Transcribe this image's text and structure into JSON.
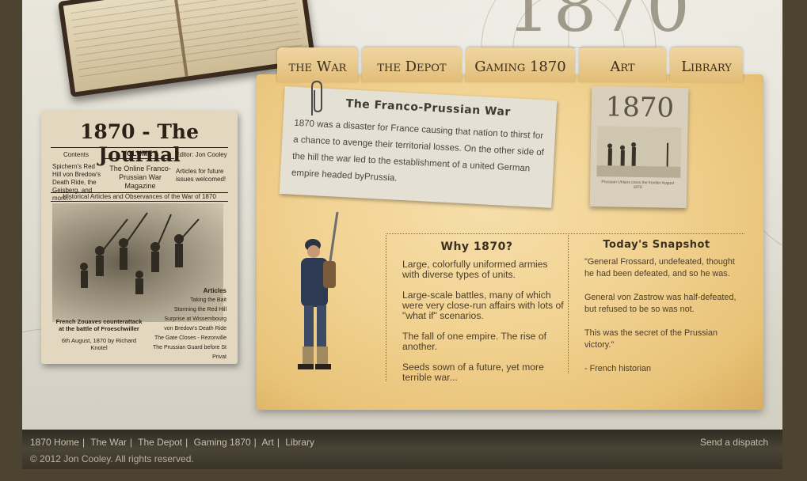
{
  "header": {
    "year_mark": "1870"
  },
  "tabs": [
    {
      "label": "the War"
    },
    {
      "label": "the Depot"
    },
    {
      "label": "Gaming 1870"
    },
    {
      "label": "Art"
    },
    {
      "label": "Library"
    }
  ],
  "journal": {
    "title": "1870 - The Journal",
    "contents_label": "Contents",
    "volume": "VOLUME 1",
    "editor": "Editor: Jon Cooley",
    "contents_text": "Spichern's Red Hill von Bredow's Death Ride, the Geisberg, and more...",
    "magazine": "The Online Franco-Prussian War Magazine",
    "future": "Articles for future issues welcomed!",
    "subtitle": "Historical Articles and Observances of the War of 1870",
    "articles_label": "Articles",
    "articles": [
      "Taking the Bait",
      "Storming the Red Hill",
      "Surprise at Wissembourg",
      "von Bredow's Death Ride",
      "The Gate Closes - Rezonville",
      "The Prussian Guard before St Privat"
    ],
    "caption": "French Zouaves counterattack at the battle of Froeschwiller",
    "caption_date": "6th August, 1870 by Richard Knotel"
  },
  "intro": {
    "title": "The Franco-Prussian War",
    "body": "1870 was a disaster for France causing that nation to thirst for a chance to avenge their territorial losses. On the other side of the hill the war led to the establishment of a united German empire headed byPrussia."
  },
  "photo": {
    "title": "1870",
    "caption": "Prussian Uhlans cross the frontier August 1870"
  },
  "why": {
    "heading": "Why 1870?",
    "items": [
      "Large, colorfully uniformed armies with diverse types of units.",
      "Large-scale battles, many of which were very close-run affairs with lots of \"what if\" scenarios.",
      "The fall of one empire. The rise of another.",
      "Seeds sown of a future, yet more terrible war..."
    ]
  },
  "snapshot": {
    "heading": "Today's Snapshot",
    "paragraphs": [
      "\"General Frossard, undefeated, thought he had been defeated, and so he was.",
      "General von Zastrow was half-defeated, but refused to be so was not.",
      "This was the secret of the Prussian victory.\"",
      "- French historian"
    ]
  },
  "footer": {
    "links": [
      "1870 Home",
      "The War",
      "The Depot",
      "Gaming 1870",
      "Art",
      "Library"
    ],
    "copyright": "© 2012 Jon Cooley. All rights reserved.",
    "send": "Send a dispatch"
  }
}
